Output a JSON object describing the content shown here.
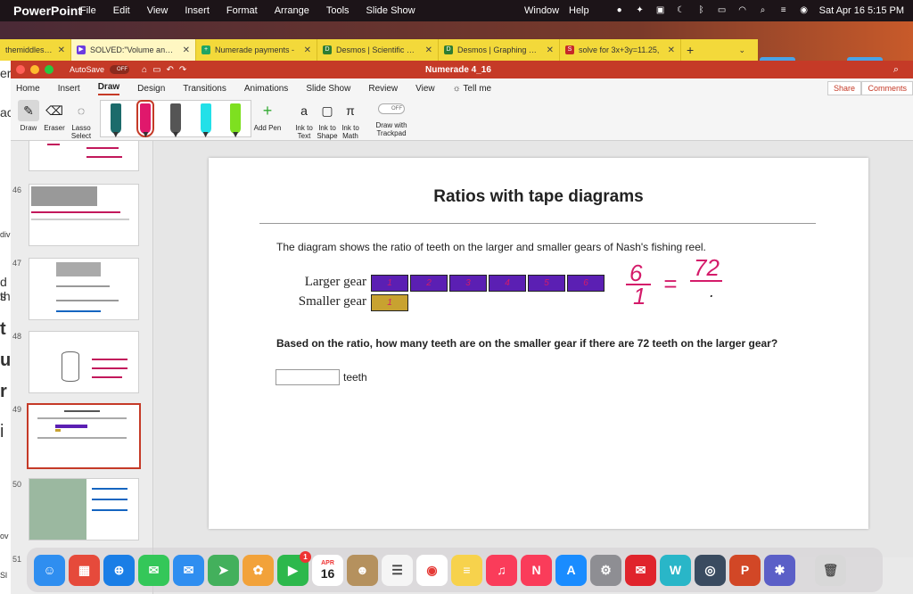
{
  "menubar": {
    "app": "PowerPoint",
    "menus": [
      "File",
      "Edit",
      "View",
      "Insert",
      "Format",
      "Arrange",
      "Tools",
      "Slide Show"
    ],
    "window": "Window",
    "help": "Help",
    "clock": "Sat Apr 16  5:15 PM"
  },
  "browser": {
    "tabs": [
      {
        "label": "themiddleschoo",
        "color": "#555555",
        "active": false
      },
      {
        "label": "SOLVED:\"Volume and su",
        "color": "#6c3ce0",
        "active": true
      },
      {
        "label": "Numerade payments - ",
        "color": "#1fa463",
        "active": false
      },
      {
        "label": "Desmos | Scientific Calc",
        "color": "#2e7d32",
        "active": false
      },
      {
        "label": "Desmos | Graphing Calc",
        "color": "#2e7d32",
        "active": false
      },
      {
        "label": "solve for 3x+3y=11.25,",
        "color": "#c62828",
        "active": false
      }
    ],
    "new_tab": "+",
    "left_remnants": [
      "er",
      "ac",
      "divi",
      "d s",
      "th",
      "t",
      "us",
      "r",
      "i",
      "ov",
      "Sl"
    ]
  },
  "ppt": {
    "autosave": "AutoSave",
    "toggle": "OFF",
    "doc_title": "Numerade 4_16",
    "ribbon_tabs": [
      "Home",
      "Insert",
      "Draw",
      "Design",
      "Transitions",
      "Animations",
      "Slide Show",
      "Review",
      "View"
    ],
    "tell_me": "Tell me",
    "share": "Share",
    "comments": "Comments",
    "tools": {
      "draw": "Draw",
      "eraser": "Eraser",
      "lasso": "Lasso Select",
      "add_pen": "Add Pen",
      "ink_to_text": "Ink to Text",
      "ink_to_shape": "Ink to Shape",
      "ink_to_math": "Ink to Math",
      "trackpad_toggle": "OFF",
      "trackpad": "Draw with Trackpad"
    },
    "pens": [
      "#1c6b6b",
      "#e0186c",
      "#555555",
      "#22e0e8",
      "#7ee020"
    ],
    "slide_numbers": [
      "46",
      "47",
      "48",
      "49",
      "50",
      "51"
    ]
  },
  "slide": {
    "title": "Ratios with tape diagrams",
    "description": "The diagram shows the ratio of teeth on the larger and smaller gears of Nash's fishing reel.",
    "larger_label": "Larger gear",
    "smaller_label": "Smaller gear",
    "larger_marks": [
      "1",
      "2",
      "3",
      "4",
      "5",
      "6"
    ],
    "smaller_marks": [
      "1"
    ],
    "question": "Based on the ratio, how many teeth are on the smaller gear if there are 72 teeth on the larger gear?",
    "answer_value": "",
    "unit": "teeth",
    "ink": {
      "num_left": "6",
      "den_left": "1",
      "equals": "=",
      "num_right": "72",
      "den_right": "."
    }
  },
  "dock": {
    "apps": [
      {
        "name": "finder-icon",
        "color": "#2f8ef0",
        "glyph": "☺"
      },
      {
        "name": "launchpad-icon",
        "color": "#e64a3b",
        "glyph": "▦"
      },
      {
        "name": "safari-icon",
        "color": "#1a7ee6",
        "glyph": "⊕"
      },
      {
        "name": "messages-icon",
        "color": "#34c759",
        "glyph": "✉"
      },
      {
        "name": "mail-icon",
        "color": "#2f8ef0",
        "glyph": "✉"
      },
      {
        "name": "maps-icon",
        "color": "#43b05c",
        "glyph": "➤"
      },
      {
        "name": "photos-icon",
        "color": "#f2a23a",
        "glyph": "✿"
      },
      {
        "name": "facetime-icon",
        "color": "#2db84c",
        "glyph": "▶",
        "badge": "1"
      },
      {
        "name": "calendar-icon",
        "color": "#ffffff",
        "glyph": "16",
        "text_color": "#222222",
        "month": "APR"
      },
      {
        "name": "contacts-icon",
        "color": "#b5915e",
        "glyph": "☻"
      },
      {
        "name": "reminders-icon",
        "color": "#f5f5f5",
        "glyph": "☰",
        "text_color": "#444444"
      },
      {
        "name": "chrome-icon",
        "color": "#ffffff",
        "glyph": "◉",
        "text_color": "#e53935"
      },
      {
        "name": "notes-icon",
        "color": "#f7d24c",
        "glyph": "≡"
      },
      {
        "name": "music-icon",
        "color": "#fa3c5a",
        "glyph": "♫"
      },
      {
        "name": "news-icon",
        "color": "#fa3c5a",
        "glyph": "N"
      },
      {
        "name": "appstore-icon",
        "color": "#1a8cff",
        "glyph": "A"
      },
      {
        "name": "settings-icon",
        "color": "#8e8e93",
        "glyph": "⚙"
      },
      {
        "name": "opera-mail-icon",
        "color": "#e0242c",
        "glyph": "✉"
      },
      {
        "name": "word-w-icon",
        "color": "#29b6c8",
        "glyph": "W"
      },
      {
        "name": "quicktime-icon",
        "color": "#3a4b60",
        "glyph": "◎"
      },
      {
        "name": "powerpoint-icon",
        "color": "#d24726",
        "glyph": "P"
      },
      {
        "name": "teams-like-icon",
        "color": "#5b5fc7",
        "glyph": "✱"
      },
      {
        "name": "trash-icon",
        "color": "#d8d8d8",
        "glyph": "🗑",
        "text_color": "#555555"
      }
    ]
  }
}
